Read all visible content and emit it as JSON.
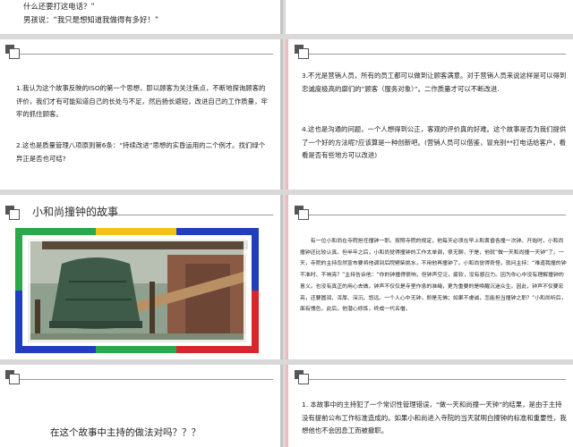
{
  "slide1": {
    "line1": "什么还要打这电话？”",
    "line2": "男孩说：“我只是想知道我做得有多好！”"
  },
  "slide2": {
    "para1": "1.我认为这个故事反映的ISO的第一个思想，即以顾客为关注焦点，不断地探询顾客的评价，我们才有可能知道自己的长处与不足，然后扬长避短，改进自己的工作质量，牢牢的抓住顾客。",
    "para2": "2.这也是质量管理八项原则第6条：“持续改进”思想的实昏运用的二个例才。找们绿个异正是否也可结?"
  },
  "slide3": {
    "para1": "3.不光是营销人员，所有的员工都可以做到让顾客满意。对于营销人员来说这样是可以得到忠诚度极高的廓们的”顾客（服务对象）”。二作质量才可以不断改进.",
    "para2": "4.这也是沟通的问题，一个人想得到公正，客观的评价真的好难。这个故事是否为我们提供了一个好的方法呢?应该算是一种创新吧。(营销人员可以借鉴，冒充别**打电话给客户，看看是否有些地方可以改进)"
  },
  "slide4": {
    "title": "小和尚撞钟的故事"
  },
  "slide5": {
    "story": "有一位小和尚在寺院担任撞钟一职。按照寺院的规定，他每天必须在早上和黄昏各撞一次钟。开始时，小和尚撞钟还比较认真。但半年之后，小和尚觉得撞钟的工作太单调，很无聊，于是，他就“做一天和尚撞一天钟”了。一天，寺院的主持忽然宣布要将他调到后院劈柴挑水，不用他再撞钟了。小和尚觉得奇怪，就问主持：“难道我撞的钟不准时、不响亮？”主持告诉他：“你的钟撞得很响，但钟声空泛，疲软，没有感召力。因为你心中没有理解撞钟的意义。也没有真正的用心去做。钟声不仅仅是寺里作息的准绳，更为重要的是唤醒沉迷众生。因此，钟声不仅要宏亮，还要圆润、浑厚、深沉、悠远。一个人心中无钟，即是无佛；如果不虔诚，怎能担当撞钟之职？”小和尚听后，面有愧色，此后，他潜心修炼，终成一代名僧。"
  },
  "slide6": {
    "question": "在这个故事中主持的做法对吗？？？"
  },
  "slide7": {
    "para1": "1. 本故事中的主持犯了一个常识性管理错误，“做一天和尚撞一天钟”的结果，是由于主持没有提前公布工作标准造成的。如果小和尚进入寺院的当天就明白撞钟的标准和重要性，我想他也不会因息工而被撤职。"
  },
  "colors": {
    "background": "#d9d9d9",
    "slide": "#ffffff",
    "pink_marker": "#f2b8b8",
    "frame_blue": "#1f3fbf",
    "frame_green": "#2aa84a",
    "frame_yellow": "#f2c21b",
    "frame_red": "#d8262b"
  }
}
